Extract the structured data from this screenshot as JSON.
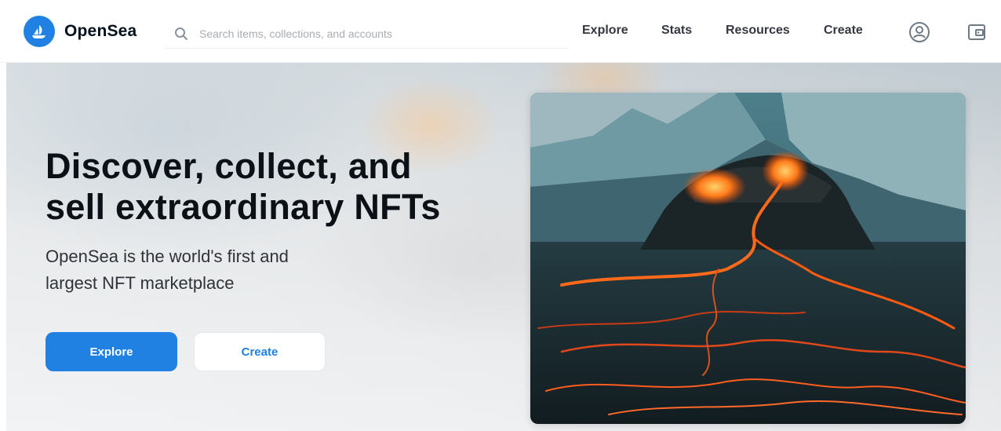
{
  "header": {
    "brand": "OpenSea",
    "search_placeholder": "Search items, collections, and accounts",
    "nav": [
      "Explore",
      "Stats",
      "Resources",
      "Create"
    ]
  },
  "hero": {
    "title_line1": "Discover, collect, and",
    "title_line2": "sell extraordinary NFTs",
    "subtitle_line1": "OpenSea is the world's first and",
    "subtitle_line2": "largest NFT marketplace",
    "primary_button": "Explore",
    "secondary_button": "Create",
    "image_icon": "volcano-image"
  },
  "icons": {
    "logo": "opensea-logo-icon",
    "search": "search-icon",
    "profile": "profile-icon",
    "wallet": "wallet-icon"
  },
  "colors": {
    "accent": "#2081e2",
    "text": "#04111d"
  }
}
